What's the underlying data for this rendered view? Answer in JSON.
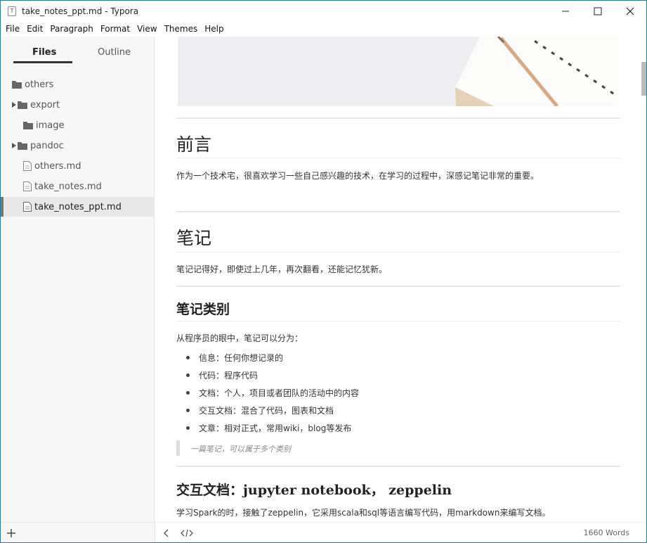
{
  "window": {
    "title": "take_notes_ppt.md - Typora",
    "app_icon_glyph": "T"
  },
  "menu": [
    "File",
    "Edit",
    "Paragraph",
    "Format",
    "View",
    "Themes",
    "Help"
  ],
  "sidebar": {
    "tabs": {
      "files": "Files",
      "outline": "Outline"
    },
    "tree": [
      {
        "name": "others",
        "type": "folder",
        "expandable": false
      },
      {
        "name": "export",
        "type": "folder",
        "expandable": true
      },
      {
        "name": "image",
        "type": "folder",
        "expandable": false
      },
      {
        "name": "pandoc",
        "type": "folder",
        "expandable": true
      },
      {
        "name": "others.md",
        "type": "file",
        "expandable": false
      },
      {
        "name": "take_notes.md",
        "type": "file",
        "expandable": false
      },
      {
        "name": "take_notes_ppt.md",
        "type": "file",
        "expandable": false,
        "selected": true
      }
    ]
  },
  "content": {
    "h1_preface": "前言",
    "p_preface": "作为一个技术宅，很喜欢学习一些自己感兴趣的技术，在学习的过程中，深感记笔记非常的重要。",
    "h1_notes": "笔记",
    "p_notes": "笔记记得好，即使过上几年，再次翻看，还能记忆犹新。",
    "h2_categories": "笔记类别",
    "p_categories": "从程序员的眼中，笔记可以分为：",
    "list": [
      "信息：任何你想记录的",
      "代码：程序代码",
      "文档：个人，项目或者团队的活动中的内容",
      "交互文档：混合了代码，图表和文档",
      "文章：相对正式，常用wiki，blog等发布"
    ],
    "quote": "一篇笔记，可以属于多个类别",
    "h2_interactive": "交互文档：jupyter notebook， zeppelin",
    "p_interactive": "学习Spark的时，接触了zeppelin，它采用scala和sql等语言编写代码，用markdown来编写文档。"
  },
  "status": {
    "word_count": "1660 Words"
  },
  "colors": {
    "accent_border": "#2b7a9a",
    "sidebar_bg": "#f7f7f7",
    "selected_row": "#e8e8e8"
  }
}
